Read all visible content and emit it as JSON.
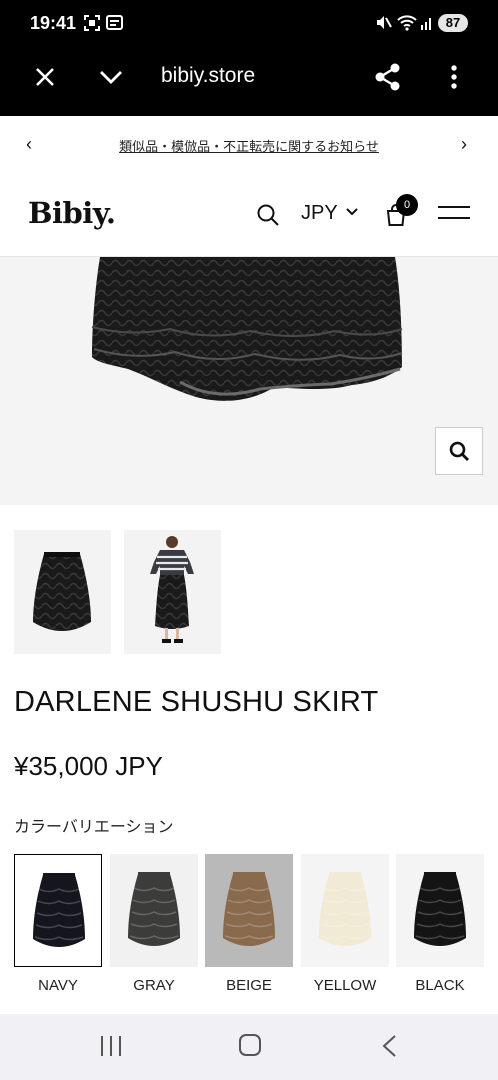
{
  "status_bar": {
    "time": "19:41",
    "battery": "87"
  },
  "browser": {
    "url": "bibiy.store",
    "close_icon": "close-icon",
    "menu_icon": "kebab-icon"
  },
  "announcement": {
    "text": "類似品・模倣品・不正転売に関するお知らせ",
    "prev": "‹",
    "next": "›"
  },
  "header": {
    "logo": "Bibiy.",
    "currency": "JPY",
    "cart_count": "0"
  },
  "product": {
    "title": "DARLENE SHUSHU SKIRT",
    "price": "¥35,000 JPY",
    "color_label": "カラーバリエーション",
    "colors": [
      {
        "label": "NAVY",
        "fabric": "#15161d",
        "bg": "#ffffff",
        "selected": true
      },
      {
        "label": "GRAY",
        "fabric": "#3c3d3b",
        "bg": "#f1f1f1",
        "selected": false
      },
      {
        "label": "BEIGE",
        "fabric": "#8a6a4d",
        "bg": "#b9b9b9",
        "selected": false
      },
      {
        "label": "YELLOW",
        "fabric": "#f1ead4",
        "bg": "#f4f4f4",
        "selected": false
      },
      {
        "label": "BLACK",
        "fabric": "#141414",
        "bg": "#f4f4f4",
        "selected": false
      }
    ]
  }
}
